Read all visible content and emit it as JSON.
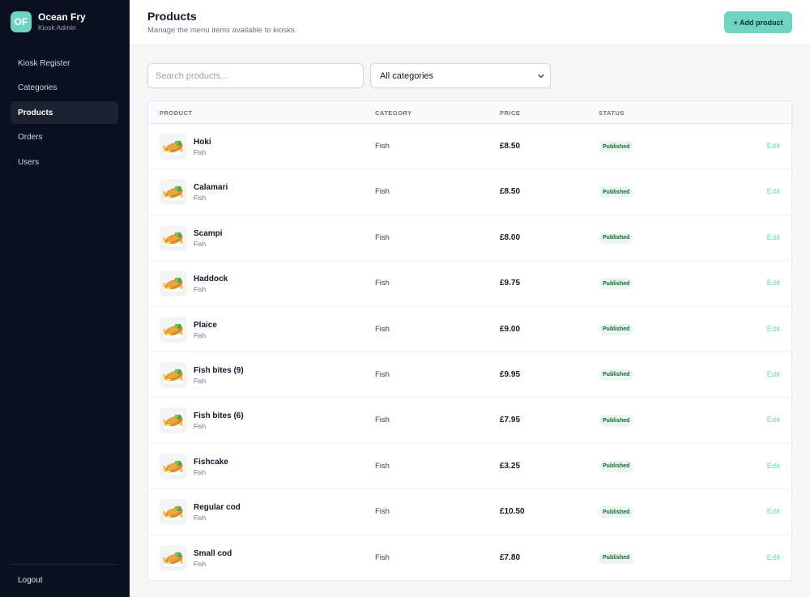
{
  "brand": {
    "initials": "OF",
    "name": "Ocean Fry",
    "subtitle": "Kiosk Admin"
  },
  "sidebar": {
    "items": [
      {
        "label": "Kiosk Register",
        "active": false
      },
      {
        "label": "Categories",
        "active": false
      },
      {
        "label": "Products",
        "active": true
      },
      {
        "label": "Orders",
        "active": false
      },
      {
        "label": "Users",
        "active": false
      }
    ],
    "logout_label": "Logout"
  },
  "header": {
    "title": "Products",
    "subtitle": "Manage the menu items available to kiosks.",
    "add_button_label": "+ Add product"
  },
  "filters": {
    "search_placeholder": "Search products...",
    "search_value": "",
    "category_selected": "All categories"
  },
  "table": {
    "columns": [
      "PRODUCT",
      "CATEGORY",
      "PRICE",
      "STATUS"
    ],
    "edit_label": "Edit",
    "rows": [
      {
        "name": "Hoki",
        "subcategory": "Fish",
        "category": "Fish",
        "price": "£8.50",
        "status": "Published"
      },
      {
        "name": "Calamari",
        "subcategory": "Fish",
        "category": "Fish",
        "price": "£8.50",
        "status": "Published"
      },
      {
        "name": "Scampi",
        "subcategory": "Fish",
        "category": "Fish",
        "price": "£8.00",
        "status": "Published"
      },
      {
        "name": "Haddock",
        "subcategory": "Fish",
        "category": "Fish",
        "price": "£9.75",
        "status": "Published"
      },
      {
        "name": "Plaice",
        "subcategory": "Fish",
        "category": "Fish",
        "price": "£9.00",
        "status": "Published"
      },
      {
        "name": "Fish bites (9)",
        "subcategory": "Fish",
        "category": "Fish",
        "price": "£9.95",
        "status": "Published"
      },
      {
        "name": "Fish bites (6)",
        "subcategory": "Fish",
        "category": "Fish",
        "price": "£7.95",
        "status": "Published"
      },
      {
        "name": "Fishcake",
        "subcategory": "Fish",
        "category": "Fish",
        "price": "£3.25",
        "status": "Published"
      },
      {
        "name": "Regular cod",
        "subcategory": "Fish",
        "category": "Fish",
        "price": "£10.50",
        "status": "Published"
      },
      {
        "name": "Small cod",
        "subcategory": "Fish",
        "category": "Fish",
        "price": "£7.80",
        "status": "Published"
      }
    ]
  },
  "colors": {
    "accent": "#6ed3c1",
    "sidebar_bg": "#0b1020",
    "published_bg": "#eaf7ef",
    "published_text": "#166534"
  },
  "icons": {
    "product_thumbnail": "fish-and-chips-icon",
    "select_chevron": "chevron-down-icon"
  }
}
